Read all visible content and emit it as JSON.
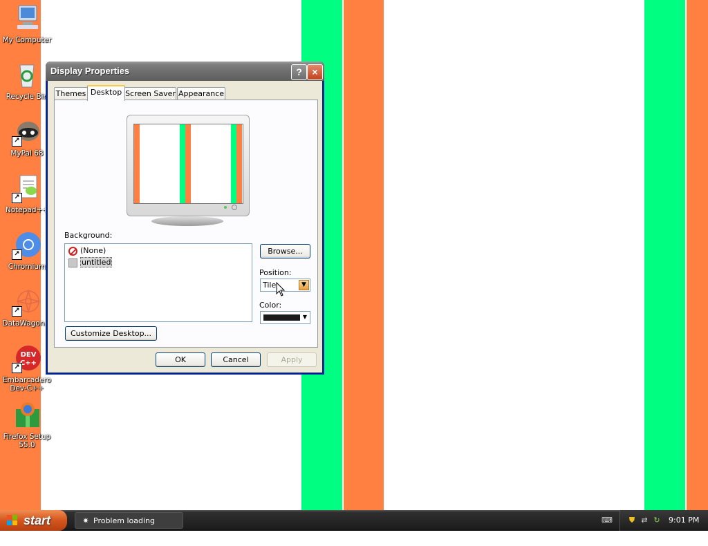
{
  "desktop": {
    "icons": [
      {
        "label": "My Computer"
      },
      {
        "label": "Recycle Bin"
      },
      {
        "label": "MyPal 68"
      },
      {
        "label": "Notepad++"
      },
      {
        "label": "Chromium"
      },
      {
        "label": "DataWagon..."
      },
      {
        "label": "Embarcadero Dev-C++"
      },
      {
        "label": "Firefox Setup 55.0"
      }
    ],
    "colors": {
      "stripe_orange": "#ff8040",
      "stripe_green": "#00ff80",
      "background": "#ffffff"
    }
  },
  "dialog": {
    "title": "Display Properties",
    "help_label": "?",
    "close_label": "×",
    "tabs": [
      {
        "label": "Themes",
        "active": false
      },
      {
        "label": "Desktop",
        "active": true
      },
      {
        "label": "Screen Saver",
        "active": false
      },
      {
        "label": "Appearance",
        "active": false
      }
    ],
    "background_label": "Background:",
    "background_items": [
      {
        "label": "(None)",
        "icon": "none-icon",
        "selected": false
      },
      {
        "label": "untitled",
        "icon": "image-icon",
        "selected": true
      }
    ],
    "browse_label": "Browse...",
    "position_label": "Position:",
    "position_value": "Tile",
    "color_label": "Color:",
    "color_value": "#1a1a1a",
    "customize_label": "Customize Desktop...",
    "ok_label": "OK",
    "cancel_label": "Cancel",
    "apply_label": "Apply"
  },
  "taskbar": {
    "start_label": "start",
    "task_items": [
      {
        "label": "Problem loading page..."
      }
    ],
    "clock": "9:01 PM"
  }
}
